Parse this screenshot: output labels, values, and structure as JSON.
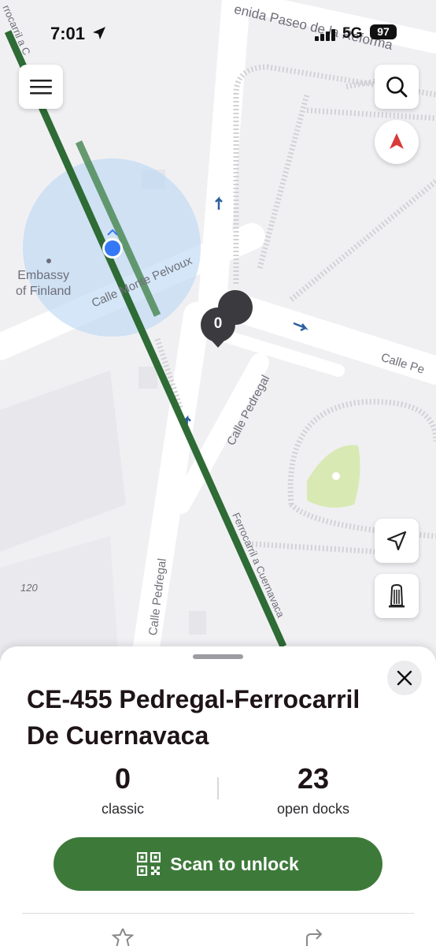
{
  "status_bar": {
    "time": "7:01",
    "network": "5G",
    "battery": "97"
  },
  "map": {
    "labels": {
      "street_top": "enida Paseo de la Reforma",
      "monte_pelvoux": "Calle Monte Pelvoux",
      "pedregal_upper": "Calle Pedregal",
      "pedregal_lower": "Calle Pedregal",
      "pedregal_right": "Calle Pe",
      "ferrocarril_bottom": "Ferrocarril a Cuernavaca",
      "ferrocarril_top": "rrocarril a C",
      "embassy_line1": "Embassy",
      "embassy_line2": "of Finland",
      "number_label": "120"
    },
    "station_pin_count": "0",
    "accent_route": "#2e6b35",
    "accent_user": "#3478f6"
  },
  "controls": {
    "menu_icon": "hamburger-icon",
    "search_icon": "search-icon",
    "compass_icon": "compass-icon",
    "locate_icon": "navigation-arrow-icon",
    "dock_icon": "bike-dock-icon"
  },
  "station": {
    "title": "CE-455 Pedregal-Ferrocarril De Cuernavaca",
    "classic_count": "0",
    "classic_label": "classic",
    "docks_count": "23",
    "docks_label": "open docks",
    "scan_label": "Scan to unlock",
    "primary_color": "#3d7a3a"
  }
}
